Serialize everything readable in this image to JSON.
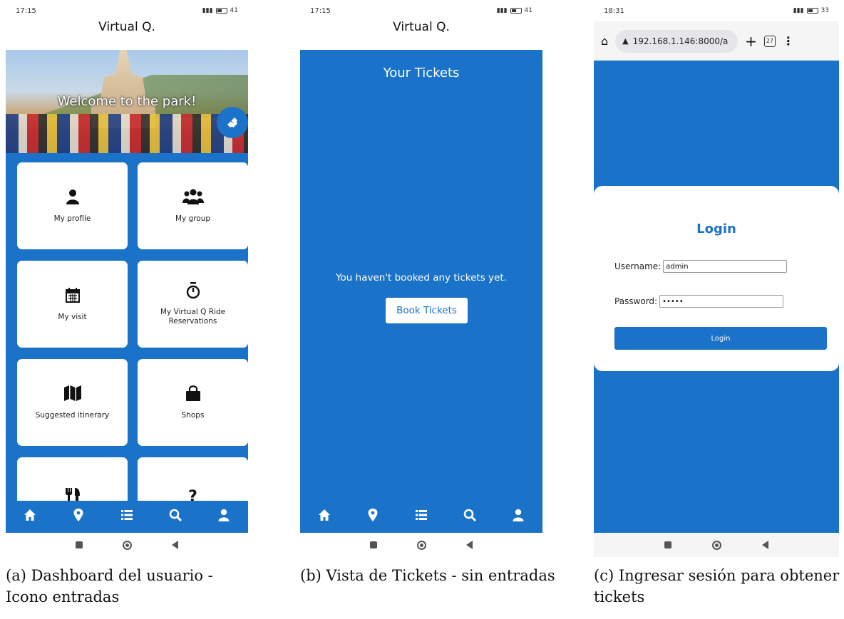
{
  "phones": {
    "dashboard": {
      "status_time": "17:15",
      "status_battery": "41",
      "app_title": "Virtual Q.",
      "hero_text": "Welcome to the park!",
      "fab_icon": "ticket-icon",
      "tiles": [
        {
          "label": "My profile",
          "icon": "user-icon"
        },
        {
          "label": "My group",
          "icon": "users-icon"
        },
        {
          "label": "My visit",
          "icon": "calendar-icon"
        },
        {
          "label": "My Virtual Q Ride Reservations",
          "icon": "stopwatch-icon"
        },
        {
          "label": "Suggested itinerary",
          "icon": "map-icon"
        },
        {
          "label": "Shops",
          "icon": "shopping-bag-icon"
        },
        {
          "label": "",
          "icon": "utensils-icon"
        },
        {
          "label": "",
          "icon": "question-icon"
        }
      ]
    },
    "tickets": {
      "status_time": "17:15",
      "status_battery": "41",
      "app_title": "Virtual Q.",
      "heading": "Your Tickets",
      "empty_message": "You haven't booked any tickets yet.",
      "book_button": "Book Tickets"
    },
    "login": {
      "status_time": "18:31",
      "status_battery": "33",
      "url": "192.168.1.146:8000/a",
      "tab_count": "27",
      "title": "Login",
      "username_label": "Username:",
      "username_value": "admin",
      "password_label": "Password:",
      "password_value": "•••••",
      "login_button": "Login"
    }
  },
  "bottom_nav": [
    "home-icon",
    "map-marker-icon",
    "list-icon",
    "search-icon",
    "user-icon"
  ],
  "captions": [
    "(a) Dashboard del usuario - Icono entradas",
    "(b) Vista de Tickets - sin entradas",
    "(c) Ingresar sesión para obtener tickets"
  ],
  "colors": {
    "primary": "#1a73c9",
    "card": "#ffffff"
  }
}
